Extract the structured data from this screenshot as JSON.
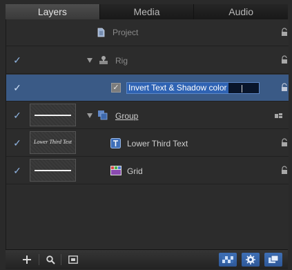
{
  "tabs": [
    {
      "label": "Layers",
      "active": true
    },
    {
      "label": "Media",
      "active": false
    },
    {
      "label": "Audio",
      "active": false
    }
  ],
  "rows": [
    {
      "label": "Project",
      "icon": "project-document-icon",
      "checked": false
    },
    {
      "label": "Rig",
      "icon": "rig-icon",
      "checked": true,
      "disclosure": "expanded"
    },
    {
      "label": "Invert Text & Shadow color",
      "icon": "checkbox-icon",
      "checked": true,
      "editing": true
    },
    {
      "label": "Group",
      "icon": "group-icon",
      "checked": true,
      "disclosure": "expanded",
      "thumbnail": "line"
    },
    {
      "label": "Lower Third Text",
      "icon": "text-layer-icon",
      "checked": true,
      "thumbnail_text": "Lower Third Text"
    },
    {
      "label": "Grid",
      "icon": "grid-layer-icon",
      "checked": true,
      "thumbnail": "line"
    }
  ],
  "toolbar": {
    "left_icons": [
      "add-icon",
      "search-icon",
      "thumbnail-view-icon"
    ],
    "right_icons": [
      "checkerboard-icon",
      "gear-icon",
      "layers-icon"
    ]
  },
  "colors": {
    "accent": "#3a5a86",
    "check": "#8fb3e0"
  }
}
